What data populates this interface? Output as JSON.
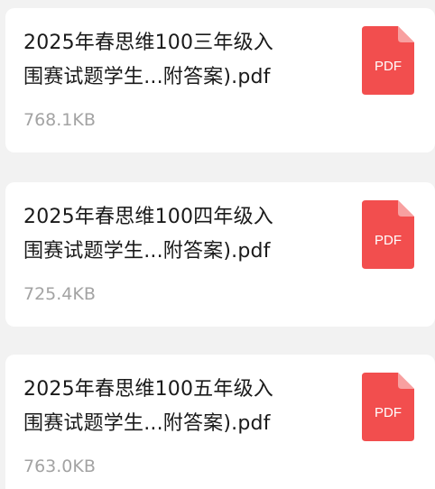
{
  "files": [
    {
      "title_line1": "2025年春思维100三年级入",
      "title_line2": "围赛试题学生...附答案).pdf",
      "size": "768.1KB",
      "icon": "pdf-file-icon",
      "icon_label": "PDF"
    },
    {
      "title_line1": "2025年春思维100四年级入",
      "title_line2": "围赛试题学生...附答案).pdf",
      "size": "725.4KB",
      "icon": "pdf-file-icon",
      "icon_label": "PDF"
    },
    {
      "title_line1": "2025年春思维100五年级入",
      "title_line2": "围赛试题学生...附答案).pdf",
      "size": "763.0KB",
      "icon": "pdf-file-icon",
      "icon_label": "PDF"
    }
  ],
  "colors": {
    "pdf_icon": "#f24e4e",
    "pdf_fold": "#f8a0a0",
    "title": "#1a1a1a",
    "size": "#a3a3a3",
    "background": "#f2f2f2",
    "card": "#ffffff"
  }
}
